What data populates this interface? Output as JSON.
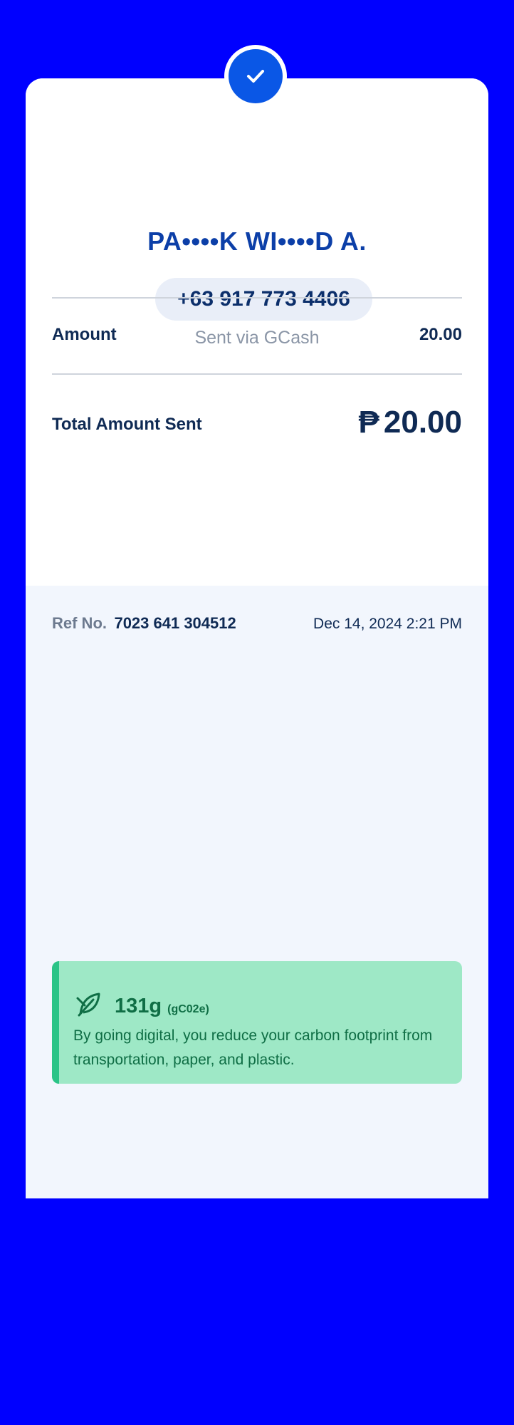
{
  "recipient": {
    "name": "PA••••K WI••••D A.",
    "phone": "+63 917 773 4406",
    "sent_via": "Sent via GCash"
  },
  "details": {
    "amount_label": "Amount",
    "amount_value": "20.00",
    "total_label": "Total Amount Sent",
    "currency_symbol": "₱",
    "total_value": "20.00"
  },
  "reference": {
    "label": "Ref No.",
    "number": "7023 641 304512",
    "datetime": "Dec 14, 2024 2:21 PM"
  },
  "carbon": {
    "icon": "leaf-icon",
    "amount": "131g",
    "unit": "(gC02e)",
    "message": "By going digital, you reduce your carbon footprint from transportation, paper, and plastic."
  },
  "colors": {
    "background": "#0000ff",
    "brand_blue": "#0a57e6",
    "card_green": "#9ee8c6",
    "accent_green": "#2bc487"
  }
}
